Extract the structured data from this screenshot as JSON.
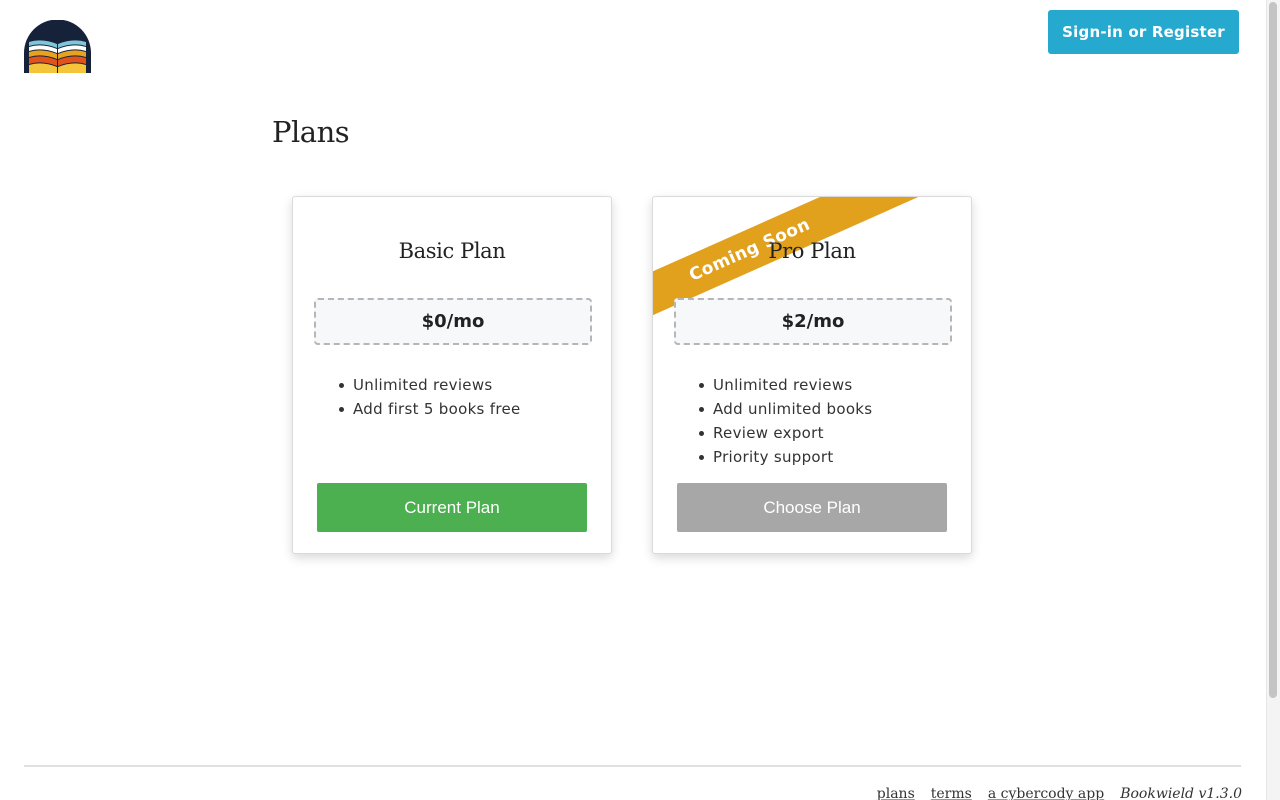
{
  "header": {
    "signin_label": "Sign-in or Register"
  },
  "page": {
    "title": "Plans"
  },
  "plans": [
    {
      "name": "Basic Plan",
      "price": "$0/mo",
      "features": [
        "Unlimited reviews",
        "Add first 5 books free"
      ],
      "button_label": "Current Plan"
    },
    {
      "name": "Pro Plan",
      "price": "$2/mo",
      "ribbon": "Coming Soon",
      "features": [
        "Unlimited reviews",
        "Add unlimited books",
        "Review export",
        "Priority support"
      ],
      "button_label": "Choose Plan"
    }
  ],
  "footer": {
    "plans_link": "plans",
    "terms_link": "terms",
    "credit_link": "a cybercody app",
    "version": "Bookwield v1.3.0"
  },
  "colors": {
    "accent": "#26a9cf",
    "current_plan": "#4caf50",
    "disabled": "#a7a7a7",
    "ribbon": "#e2a11d"
  },
  "icons": {
    "logo": "book-logo-icon"
  }
}
